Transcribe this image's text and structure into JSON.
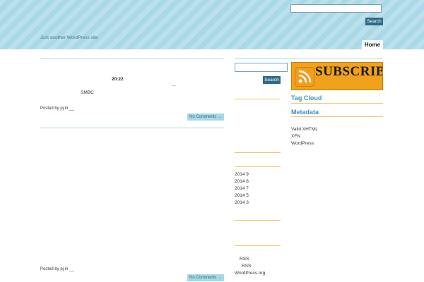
{
  "header": {
    "search_value": "",
    "search_button": "Search",
    "tagline": "Just another WordPress site",
    "nav": [
      {
        "label": "Home"
      }
    ]
  },
  "posts": [
    {
      "title": "20:22",
      "ellipsis": "...",
      "excerpt": "SMBC",
      "meta": "Posted by pj in __",
      "comments": "No Comments →"
    },
    {
      "meta": "Posted by pj in __",
      "comments": "No Comments →"
    }
  ],
  "sidebar_left": {
    "search_button": "Search",
    "archives": [
      "2014 9",
      "2014 8",
      "2014 7",
      "2014 5",
      "2014 3"
    ],
    "feeds": [
      "RSS",
      "RSS",
      "WordPress.org"
    ]
  },
  "sidebar_right": {
    "subscribe_text": "SUBSCRIBE",
    "tag_cloud": "Tag Cloud",
    "metadata": "Metadata",
    "meta_links": [
      "Valid XHTML",
      "XFN",
      "WordPress"
    ]
  },
  "colors": {
    "accent": "#a9d8e6",
    "button": "#2d6b86",
    "heading": "#3b93b8",
    "divider": "#f1c56b"
  }
}
